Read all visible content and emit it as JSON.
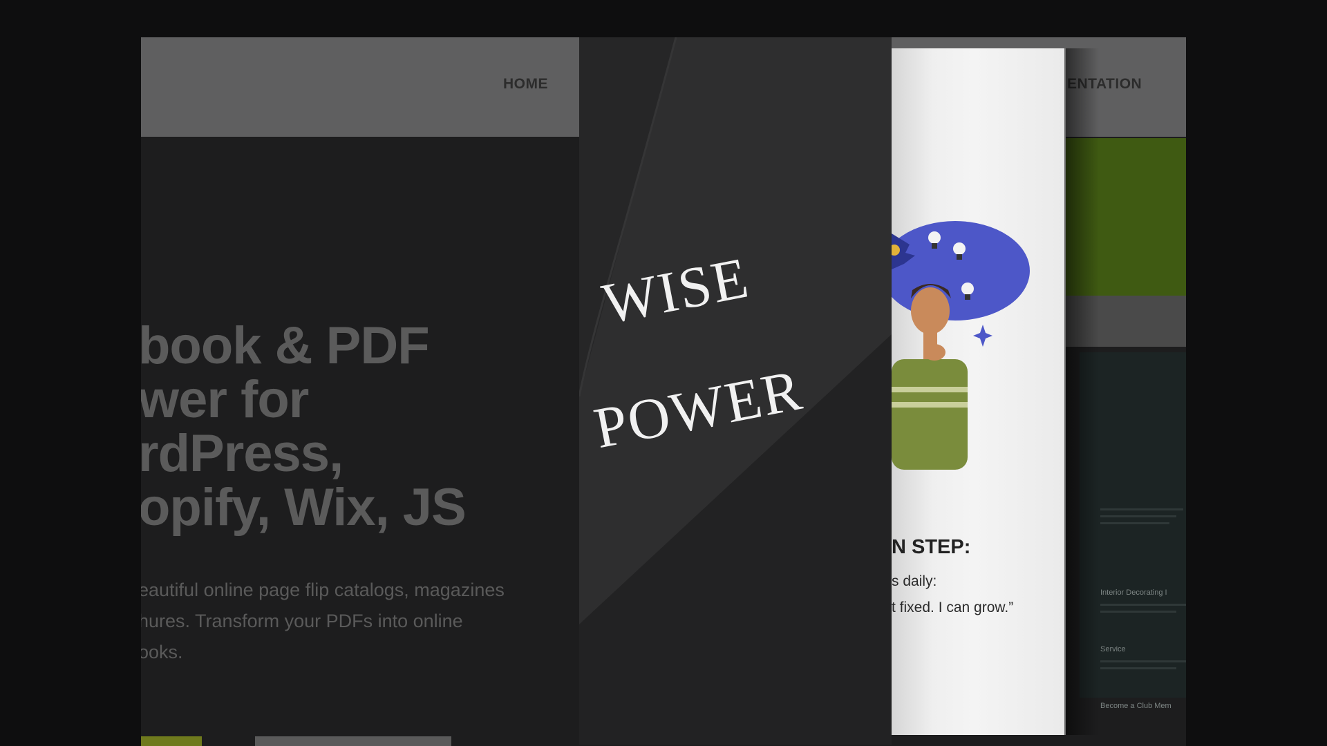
{
  "background_site": {
    "nav": {
      "home": "HOME",
      "documentation": "ENTATION"
    },
    "hero": {
      "title_lines": [
        "book & PDF",
        "wer for",
        "rdPress,",
        "opify, Wix, JS"
      ],
      "subtitle_lines": [
        "eautiful online page flip catalogs, magazines",
        "hures. Transform your PDFs into online",
        "ooks."
      ]
    },
    "side_card": {
      "items": [
        "Interior Decorating I",
        "Service",
        "Become a Club Mem"
      ]
    }
  },
  "fold_page": {
    "word1": "WISE",
    "word2": "POWER"
  },
  "paper_page": {
    "heading": "N STEP:",
    "line1": "s daily:",
    "line2": "t fixed. I can grow.”"
  },
  "colors": {
    "page_background": "#0e0e0f",
    "header_gray": "#5f5f60",
    "accent_green": "#3f5a12",
    "illustration_blue": "#4d57c8",
    "shirt_green": "#7a8c3c"
  }
}
